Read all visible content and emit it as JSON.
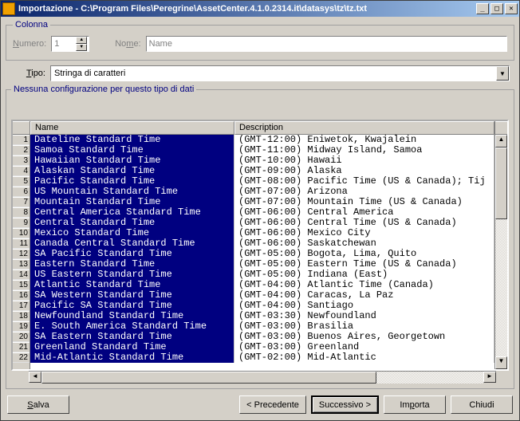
{
  "titlebar": {
    "title": "Importazione - C:\\Program Files\\Peregrine\\AssetCenter.4.1.0.2314.it\\datasys\\tz\\tz.txt"
  },
  "colonna": {
    "legend": "Colonna",
    "numero_label": "Numero:",
    "numero_value": "1",
    "nome_label": "Nome:",
    "nome_value": "Name"
  },
  "tipo": {
    "label": "Tipo:",
    "value": "Stringa di caratteri"
  },
  "config": {
    "legend": "Nessuna configurazione per questo tipo di dati"
  },
  "table": {
    "columns": {
      "name": "Name",
      "description": "Description"
    },
    "rows": [
      {
        "n": "1",
        "name": "Dateline Standard Time",
        "desc": "(GMT-12:00) Eniwetok, Kwajalein"
      },
      {
        "n": "2",
        "name": "Samoa Standard Time",
        "desc": "(GMT-11:00) Midway Island, Samoa"
      },
      {
        "n": "3",
        "name": "Hawaiian Standard Time",
        "desc": "(GMT-10:00) Hawaii"
      },
      {
        "n": "4",
        "name": "Alaskan Standard Time",
        "desc": "(GMT-09:00) Alaska"
      },
      {
        "n": "5",
        "name": "Pacific Standard Time",
        "desc": "(GMT-08:00) Pacific Time (US & Canada); Tij"
      },
      {
        "n": "6",
        "name": "US Mountain Standard Time",
        "desc": "(GMT-07:00) Arizona"
      },
      {
        "n": "7",
        "name": "Mountain Standard Time",
        "desc": "(GMT-07:00) Mountain Time (US & Canada)"
      },
      {
        "n": "8",
        "name": "Central America Standard Time",
        "desc": "(GMT-06:00) Central America"
      },
      {
        "n": "9",
        "name": "Central Standard Time",
        "desc": "(GMT-06:00) Central Time (US & Canada)"
      },
      {
        "n": "10",
        "name": "Mexico Standard Time",
        "desc": "(GMT-06:00) Mexico City"
      },
      {
        "n": "11",
        "name": "Canada Central Standard Time",
        "desc": "(GMT-06:00) Saskatchewan"
      },
      {
        "n": "12",
        "name": "SA Pacific Standard Time",
        "desc": "(GMT-05:00) Bogota, Lima, Quito"
      },
      {
        "n": "13",
        "name": "Eastern Standard Time",
        "desc": "(GMT-05:00) Eastern Time (US & Canada)"
      },
      {
        "n": "14",
        "name": "US Eastern Standard Time",
        "desc": "(GMT-05:00) Indiana (East)"
      },
      {
        "n": "15",
        "name": "Atlantic Standard Time",
        "desc": "(GMT-04:00) Atlantic Time (Canada)"
      },
      {
        "n": "16",
        "name": "SA Western Standard Time",
        "desc": "(GMT-04:00) Caracas, La Paz"
      },
      {
        "n": "17",
        "name": "Pacific SA Standard Time",
        "desc": "(GMT-04:00) Santiago"
      },
      {
        "n": "18",
        "name": "Newfoundland Standard Time",
        "desc": "(GMT-03:30) Newfoundland"
      },
      {
        "n": "19",
        "name": "E. South America Standard Time",
        "desc": "(GMT-03:00) Brasilia"
      },
      {
        "n": "20",
        "name": "SA Eastern Standard Time",
        "desc": "(GMT-03:00) Buenos Aires, Georgetown"
      },
      {
        "n": "21",
        "name": "Greenland Standard Time",
        "desc": "(GMT-03:00) Greenland"
      },
      {
        "n": "22",
        "name": "Mid-Atlantic Standard Time",
        "desc": "(GMT-02:00) Mid-Atlantic"
      }
    ]
  },
  "buttons": {
    "salva": "Salva",
    "precedente": "< Precedente",
    "successivo": "Successivo >",
    "importa": "Importa",
    "chiudi": "Chiudi"
  }
}
